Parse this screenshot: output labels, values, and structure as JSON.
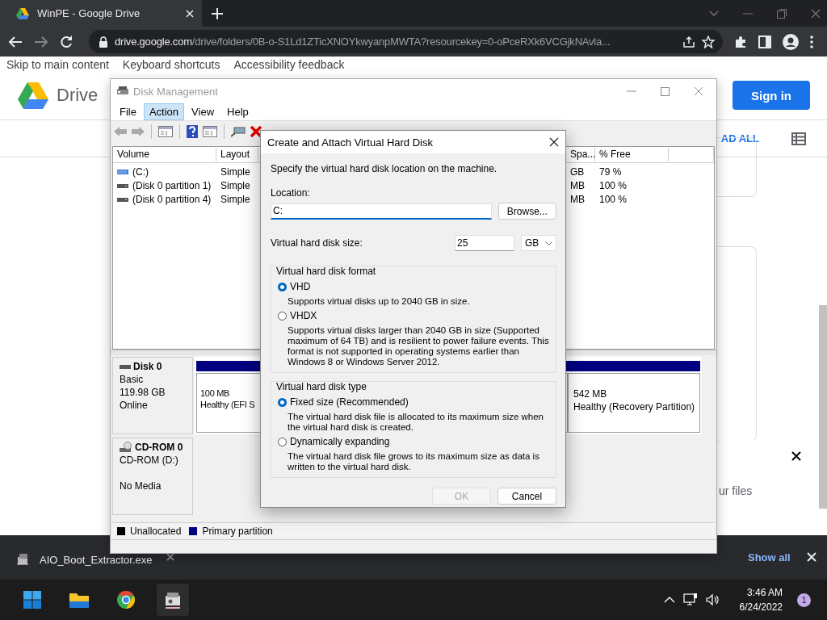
{
  "browser": {
    "tab_title": "WinPE - Google Drive",
    "url_host": "drive.google.com",
    "url_path": "/drive/folders/0B-o-S1Ld1ZTicXNOYkwyanpMWTA?resourcekey=0-oPceRXk6VCGjkNAvla..."
  },
  "page": {
    "skip_links": [
      "Skip to main content",
      "Keyboard shortcuts",
      "Accessibility feedback"
    ],
    "logo_text": "Drive",
    "sign_in": "Sign in",
    "download_all": "AD ALL",
    "snackbar_text": "ur files"
  },
  "disk_management": {
    "title": "Disk Management",
    "menu": [
      {
        "label": "File",
        "selected": false
      },
      {
        "label": "Action",
        "selected": true
      },
      {
        "label": "View",
        "selected": false
      },
      {
        "label": "Help",
        "selected": false
      }
    ],
    "columns": [
      "Volume",
      "Layout",
      "Spa...",
      "% Free"
    ],
    "volumes": [
      {
        "name": "(C:)",
        "kind": "system",
        "layout": "Simple",
        "free_space": "GB",
        "percent_free": "79 %"
      },
      {
        "name": "(Disk 0 partition 1)",
        "kind": "plain",
        "layout": "Simple",
        "free_space": "MB",
        "percent_free": "100 %"
      },
      {
        "name": "(Disk 0 partition 4)",
        "kind": "plain",
        "layout": "Simple",
        "free_space": "MB",
        "percent_free": "100 %"
      }
    ],
    "disks": [
      {
        "name": "Disk 0",
        "kind": "disk",
        "lines": [
          "Basic",
          "119.98 GB",
          "Online"
        ],
        "partitions": [
          {
            "size": "100 MB",
            "status": "Healthy (EFI S"
          },
          {
            "size": "542 MB",
            "status": "Healthy (Recovery Partition)"
          }
        ]
      },
      {
        "name": "CD-ROM 0",
        "kind": "cdrom",
        "lines": [
          "CD-ROM (D:)",
          "No Media"
        ]
      }
    ],
    "legend": [
      {
        "label": "Unallocated",
        "color": "#000000"
      },
      {
        "label": "Primary partition",
        "color": "#000080"
      }
    ]
  },
  "dialog": {
    "title": "Create and Attach Virtual Hard Disk",
    "description": "Specify the virtual hard disk location on the machine.",
    "location_label": "Location:",
    "location_value": "C:",
    "browse": "Browse...",
    "size_label": "Virtual hard disk size:",
    "size_value": "25",
    "unit": "GB",
    "format_group": "Virtual hard disk format",
    "format_options": [
      {
        "label": "VHD",
        "selected": true,
        "description": "Supports virtual disks up to 2040 GB in size."
      },
      {
        "label": "VHDX",
        "selected": false,
        "description": "Supports virtual disks larger than 2040 GB in size (Supported maximum of 64 TB) and is resilient to power failure events. This format is not supported in operating systems earlier than Windows 8 or Windows Server 2012."
      }
    ],
    "type_group": "Virtual hard disk type",
    "type_options": [
      {
        "label": "Fixed size (Recommended)",
        "selected": true,
        "description": "The virtual hard disk file is allocated to its maximum size when the virtual hard disk is created."
      },
      {
        "label": "Dynamically expanding",
        "selected": false,
        "description": "The virtual hard disk file grows to its maximum size as data is written to the virtual hard disk."
      }
    ],
    "ok": {
      "label": "OK",
      "disabled": true
    },
    "cancel": {
      "label": "Cancel",
      "disabled": false
    }
  },
  "download_shelf": {
    "file": "AIO_Boot_Extractor.exe",
    "show_all": "Show all"
  },
  "taskbar": {
    "time": "3:46 AM",
    "date": "6/24/2022",
    "notifications": "1"
  }
}
